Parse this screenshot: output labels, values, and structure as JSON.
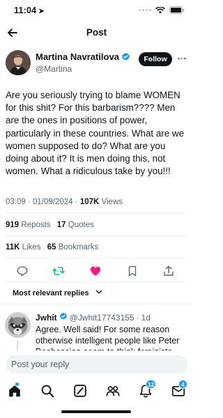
{
  "status_bar": {
    "time": "11:04",
    "location_icon": "location-arrow-icon"
  },
  "nav": {
    "title": "Post",
    "back_icon": "arrow-left-icon"
  },
  "author": {
    "name": "Martina Navratilova",
    "handle": "@Martina",
    "follow_label": "Follow",
    "verified_icon": "verified-badge-icon"
  },
  "tweet": {
    "text": "Are you seriously trying to blame WOMEN for this shit? For this barbarism???? Men are the ones in positions of power, particularly in these countries. What are we women supposed to do? What are you doing about it? It is men doing this, not women. What a ridiculous take by you!!!",
    "time": "03:09",
    "date": "01/09/2024",
    "views_count": "107K",
    "views_label": "Views"
  },
  "stats": {
    "reposts_count": "919",
    "reposts_label": "Reposts",
    "quotes_count": "17",
    "quotes_label": "Quotes",
    "likes_count": "11K",
    "likes_label": "Likes",
    "bookmarks_count": "65",
    "bookmarks_label": "Bookmarks"
  },
  "actions": [
    "reply-icon",
    "repost-icon",
    "like-icon",
    "bookmark-icon",
    "share-icon"
  ],
  "colors": {
    "repost_active": "#00ba7c",
    "like_active": "#f91880",
    "accent": "#1d9bf0"
  },
  "replies_sort": {
    "label": "Most relevant replies"
  },
  "reply": {
    "name": "Jwhit",
    "handle": "@Jwhit17743155",
    "time": "1d",
    "text": "Agree. Well said! For some reason otherwise intelligent people like Peter Boghossian seem to think feminists"
  },
  "composer": {
    "placeholder": "Post your reply"
  },
  "tabbar": {
    "items": [
      "home-icon",
      "search-icon",
      "grok-icon",
      "communities-icon",
      "notifications-icon",
      "messages-icon"
    ],
    "notifications_badge": "12",
    "messages_badge": "4"
  }
}
